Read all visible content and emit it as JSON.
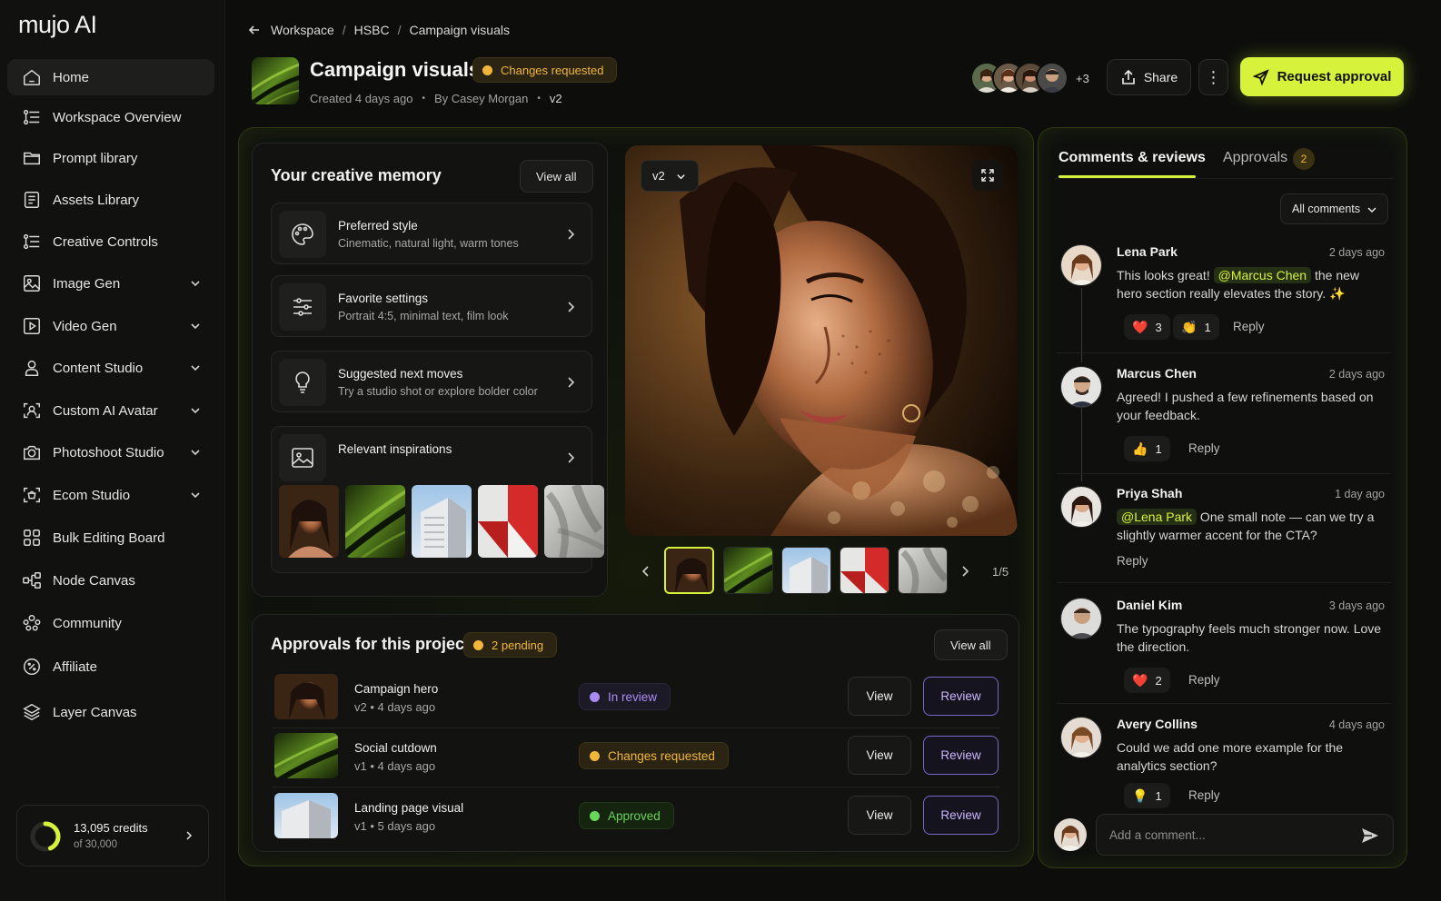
{
  "app": {
    "logo": "mujo AI"
  },
  "sidebar": {
    "items": [
      {
        "label": "Home",
        "icon": "home-icon"
      },
      {
        "label": "Workspace Overview",
        "icon": "workflow-icon"
      },
      {
        "label": "Prompt library",
        "icon": "folder-icon"
      },
      {
        "label": "Assets Library",
        "icon": "list-icon"
      },
      {
        "label": "Creative Controls",
        "icon": "workflow-icon"
      },
      {
        "label": "Image Gen",
        "icon": "image-icon"
      },
      {
        "label": "Video Gen",
        "icon": "play-icon"
      },
      {
        "label": "Content Studio",
        "icon": "user-icon"
      },
      {
        "label": "Custom AI Avatar",
        "icon": "avatar-scan-icon"
      },
      {
        "label": "Photoshoot Studio",
        "icon": "camera-icon"
      },
      {
        "label": "Ecom Studio",
        "icon": "bag-icon"
      },
      {
        "label": "Bulk Editing Board",
        "icon": "grid-icon"
      },
      {
        "label": "Node Canvas",
        "icon": "nodes-icon"
      },
      {
        "label": "Community",
        "icon": "community-icon"
      },
      {
        "label": "Affiliate",
        "icon": "percent-badge-icon"
      },
      {
        "label": "Layer Canvas",
        "icon": "layers-icon"
      }
    ],
    "credits": {
      "value": "13,095 credits",
      "sub": "of 30,000",
      "used_fraction": 0.436
    }
  },
  "breadcrumb": {
    "items": [
      "Workspace",
      "HSBC",
      "Campaign visuals"
    ]
  },
  "header": {
    "title": "Campaign visuals",
    "status": "Changes requested",
    "created": "Created 4 days ago",
    "author": "By Casey Morgan",
    "version": "v2",
    "more_collaborators": "+3",
    "share_label": "Share",
    "more_label": "⋮",
    "approve_label": "Request approval"
  },
  "memory": {
    "title": "Your creative memory",
    "view_all": "View all",
    "cards": [
      {
        "title": "Preferred style",
        "sub": "Cinematic, natural light, warm tones",
        "icon": "palette-icon"
      },
      {
        "title": "Favorite settings",
        "sub": "Portrait 4:5, minimal text, film look",
        "icon": "sliders-icon"
      },
      {
        "title": "Suggested next moves",
        "sub": "Try a studio shot or explore bolder color",
        "icon": "lightbulb-icon"
      },
      {
        "title": "Relevant inspirations",
        "sub": "",
        "icon": "image-icon"
      }
    ]
  },
  "preview": {
    "version": "v2",
    "counter": "1/5"
  },
  "approvals": {
    "title": "Approvals for this project",
    "pending": "2 pending",
    "view_all": "View all",
    "rows": [
      {
        "name": "Campaign hero",
        "sub": "v2  •  4 days ago",
        "status": "In review",
        "view": "View",
        "review": "Review"
      },
      {
        "name": "Social cutdown",
        "sub": "v1  •  4 days ago",
        "status": "Changes requested",
        "view": "View",
        "review": "Review"
      },
      {
        "name": "Landing page visual",
        "sub": "v1  •  5 days ago",
        "status": "Approved",
        "view": "View",
        "review": "Review"
      }
    ]
  },
  "comments_panel": {
    "tab_comments": "Comments & reviews",
    "tab_approvals": "Approvals",
    "approvals_count": "2",
    "filter": "All comments",
    "comments": [
      {
        "name": "Lena Park",
        "time": "2 days ago",
        "pre": "This looks great! ",
        "mention": "@Marcus Chen",
        "post": " the new hero section really elevates the story. ✨",
        "reactions": [
          {
            "emoji": "❤️",
            "count": "3"
          },
          {
            "emoji": "👏",
            "count": "1"
          }
        ],
        "reply": "Reply"
      },
      {
        "name": "Marcus Chen",
        "time": "2 days ago",
        "pre": "Agreed! I pushed a few refinements based on your feedback.",
        "mention": "",
        "post": "",
        "reactions": [
          {
            "emoji": "👍",
            "count": "1"
          }
        ],
        "reply": "Reply"
      },
      {
        "name": "Priya Shah",
        "time": "1 day ago",
        "pre": "",
        "mention": "@Lena Park",
        "post": " One small note — can we try a slightly warmer accent for the CTA?",
        "reactions": [],
        "reply": "Reply"
      },
      {
        "name": "Daniel Kim",
        "time": "3 days ago",
        "pre": "The typography feels much stronger now. Love the direction.",
        "mention": "",
        "post": "",
        "reactions": [
          {
            "emoji": "❤️",
            "count": "2"
          }
        ],
        "reply": "Reply"
      },
      {
        "name": "Avery Collins",
        "time": "4 days ago",
        "pre": "Could we add one more example for the analytics section?",
        "mention": "",
        "post": "",
        "reactions": [
          {
            "emoji": "💡",
            "count": "1"
          }
        ],
        "reply": "Reply"
      }
    ],
    "composer_placeholder": "Add a comment..."
  },
  "colors": {
    "accent": "#d7f23a",
    "warning": "#f2b63a",
    "review": "#a98cf2",
    "approved": "#6bd45a"
  }
}
